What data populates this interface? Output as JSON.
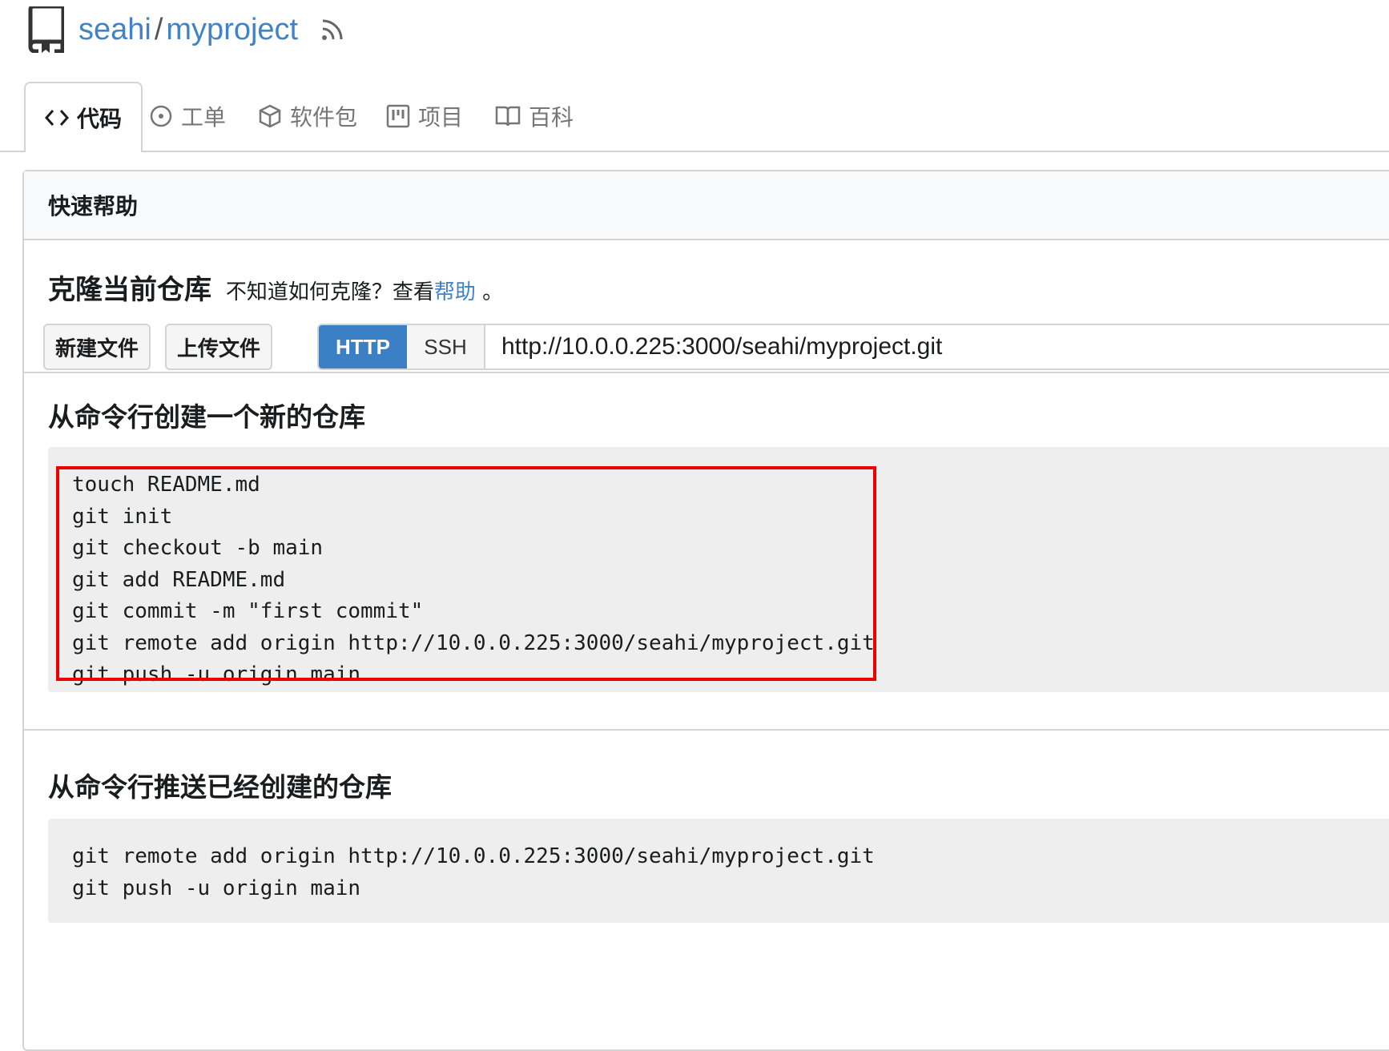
{
  "repo": {
    "owner": "seahi",
    "separator": "/",
    "name": "myproject"
  },
  "tabs": [
    {
      "label": "代码",
      "icon": "code-icon",
      "active": true
    },
    {
      "label": "工单",
      "icon": "issue-icon"
    },
    {
      "label": "软件包",
      "icon": "package-icon"
    },
    {
      "label": "项目",
      "icon": "project-icon"
    },
    {
      "label": "百科",
      "icon": "wiki-book-icon"
    }
  ],
  "quick_help": {
    "header": "快速帮助",
    "clone_title": "克隆当前仓库",
    "clone_hint": "不知道如何克隆？查看",
    "help_link": "帮助",
    "clone_hint_end": "。",
    "new_file_button": "新建文件",
    "upload_file_button": "上传文件",
    "http_label": "HTTP",
    "ssh_label": "SSH",
    "clone_url": "http://10.0.0.225:3000/seahi/myproject.git"
  },
  "new_repo": {
    "title": "从命令行创建一个新的仓库",
    "lines": [
      "touch README.md",
      "git init",
      "git checkout -b main",
      "git add README.md",
      "git commit -m \"first commit\"",
      "git remote add origin http://10.0.0.225:3000/seahi/myproject.git",
      "git push -u origin main"
    ]
  },
  "push_existing": {
    "title": "从命令行推送已经创建的仓库",
    "lines": [
      "git remote add origin http://10.0.0.225:3000/seahi/myproject.git",
      "git push -u origin main"
    ]
  },
  "colors": {
    "link": "#4183c4",
    "http_active": "#3b7fc4",
    "highlight_border": "#ec0000",
    "code_bg": "#eeeeee"
  }
}
